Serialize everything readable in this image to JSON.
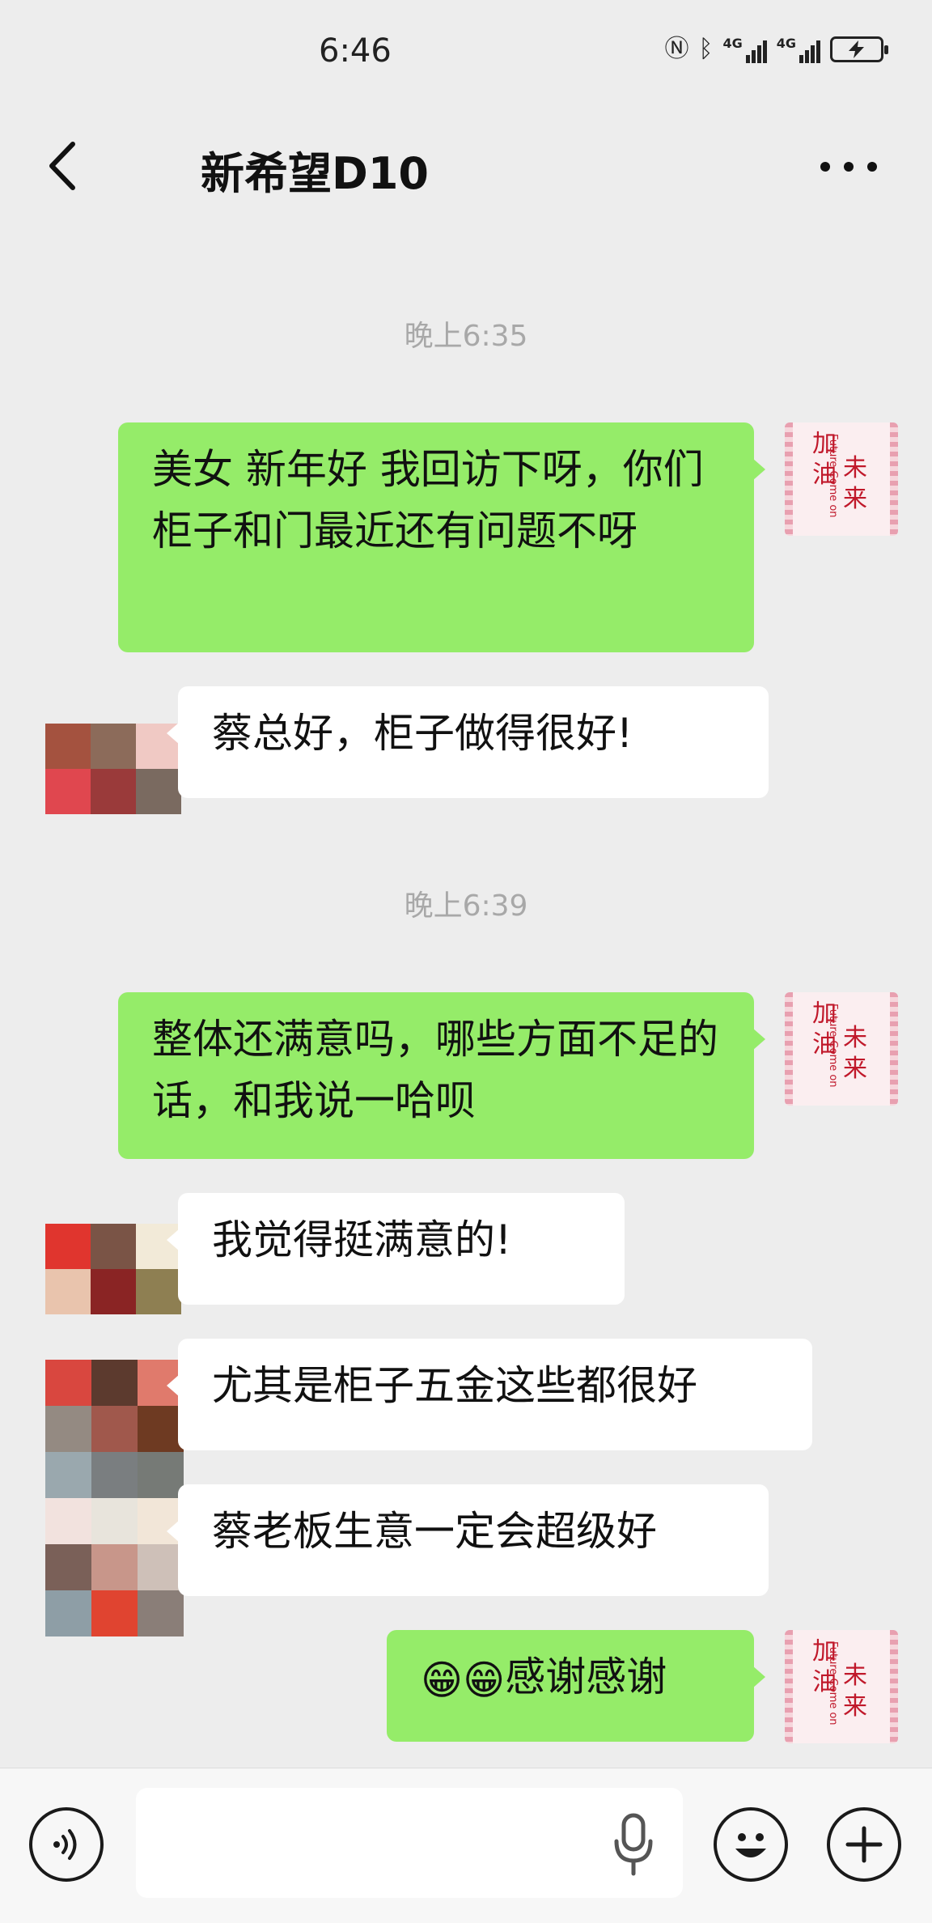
{
  "status_bar": {
    "time": "6:46",
    "network_1": "4G",
    "network_2": "4G"
  },
  "header": {
    "title": "新希望D10",
    "back_icon": "chevron-left-icon",
    "more_icon": "more-dots-icon"
  },
  "timestamps": [
    "晚上6:35",
    "晚上6:39"
  ],
  "self_avatar": {
    "text_cn_1": "加油",
    "text_cn_2": "未来",
    "text_en": "Future Come on"
  },
  "messages": [
    {
      "side": "out",
      "text": "美女  新年好  我回访下呀，你们柜子和门最近还有问题不呀"
    },
    {
      "side": "in",
      "text": "蔡总好，柜子做得很好!"
    },
    {
      "side": "out",
      "text": "整体还满意吗，哪些方面不足的话，和我说一哈呗"
    },
    {
      "side": "in",
      "text": "我觉得挺满意的!"
    },
    {
      "side": "in",
      "text": "尤其是柜子五金这些都很好"
    },
    {
      "side": "in",
      "text": "蔡老板生意一定会超级好"
    },
    {
      "side": "out",
      "emoji": "😁😁",
      "text": "感谢感谢"
    }
  ],
  "input_bar": {
    "voice_icon": "voice-mode-icon",
    "mic_icon": "microphone-icon",
    "emoji_icon": "emoji-smile-icon",
    "plus_icon": "plus-icon",
    "input_value": ""
  },
  "colors": {
    "outgoing_bubble": "#95ec69",
    "incoming_bubble": "#ffffff",
    "background": "#ededed",
    "timestamp_text": "#a8a8a8"
  }
}
